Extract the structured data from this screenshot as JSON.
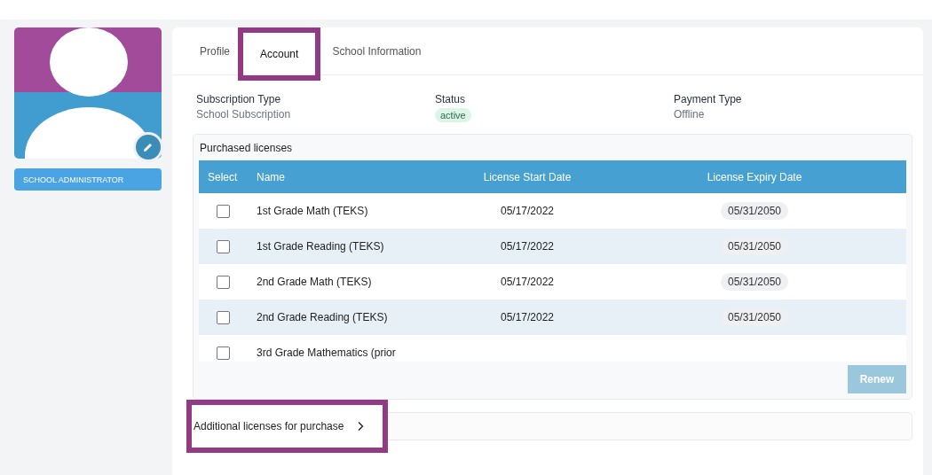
{
  "sidebar": {
    "role": "SCHOOL ADMINISTRATOR"
  },
  "tabs": [
    {
      "label": "Profile",
      "selected": false,
      "highlighted": false
    },
    {
      "label": "Account",
      "selected": true,
      "highlighted": true
    },
    {
      "label": "School Information",
      "selected": false,
      "highlighted": false
    }
  ],
  "summary": [
    {
      "label": "Subscription Type",
      "value": "School Subscription",
      "kind": "text"
    },
    {
      "label": "Status",
      "value": "active",
      "kind": "badge"
    },
    {
      "label": "Payment Type",
      "value": "Offline",
      "kind": "text"
    }
  ],
  "licenses": {
    "title": "Purchased licenses",
    "columns": [
      "Select",
      "Name",
      "License Start Date",
      "License Expiry Date"
    ],
    "rows": [
      {
        "checked": false,
        "name": "1st Grade Math (TEKS)",
        "start": "05/17/2022",
        "expiry": "05/31/2050"
      },
      {
        "checked": false,
        "name": "1st Grade Reading (TEKS)",
        "start": "05/17/2022",
        "expiry": "05/31/2050"
      },
      {
        "checked": false,
        "name": "2nd Grade Math (TEKS)",
        "start": "05/17/2022",
        "expiry": "05/31/2050"
      },
      {
        "checked": false,
        "name": "2nd Grade Reading (TEKS)",
        "start": "05/17/2022",
        "expiry": "05/31/2050"
      },
      {
        "checked": false,
        "name": "3rd Grade Mathematics (prior",
        "start": "",
        "expiry": ""
      }
    ],
    "renew": {
      "label": "Renew",
      "disabled": true
    }
  },
  "additional": {
    "label": "Additional licenses for purchase",
    "highlighted": true
  }
}
